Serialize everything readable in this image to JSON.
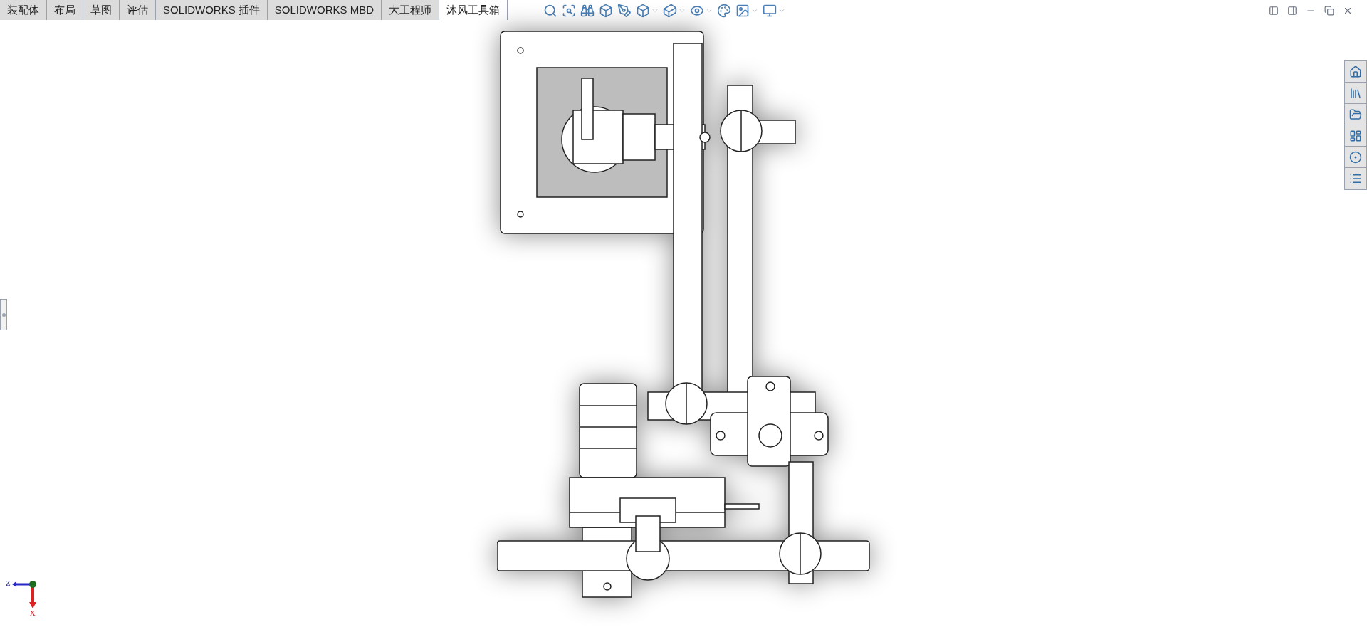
{
  "tabs": [
    {
      "label": "装配体",
      "selected": false
    },
    {
      "label": "布局",
      "selected": false
    },
    {
      "label": "草图",
      "selected": false
    },
    {
      "label": "评估",
      "selected": false
    },
    {
      "label": "SOLIDWORKS 插件",
      "selected": false
    },
    {
      "label": "SOLIDWORKS MBD",
      "selected": false
    },
    {
      "label": "大工程师",
      "selected": false
    },
    {
      "label": "沐风工具箱",
      "selected": true
    }
  ],
  "triad": {
    "z_label": "Z",
    "x_label": "X"
  }
}
